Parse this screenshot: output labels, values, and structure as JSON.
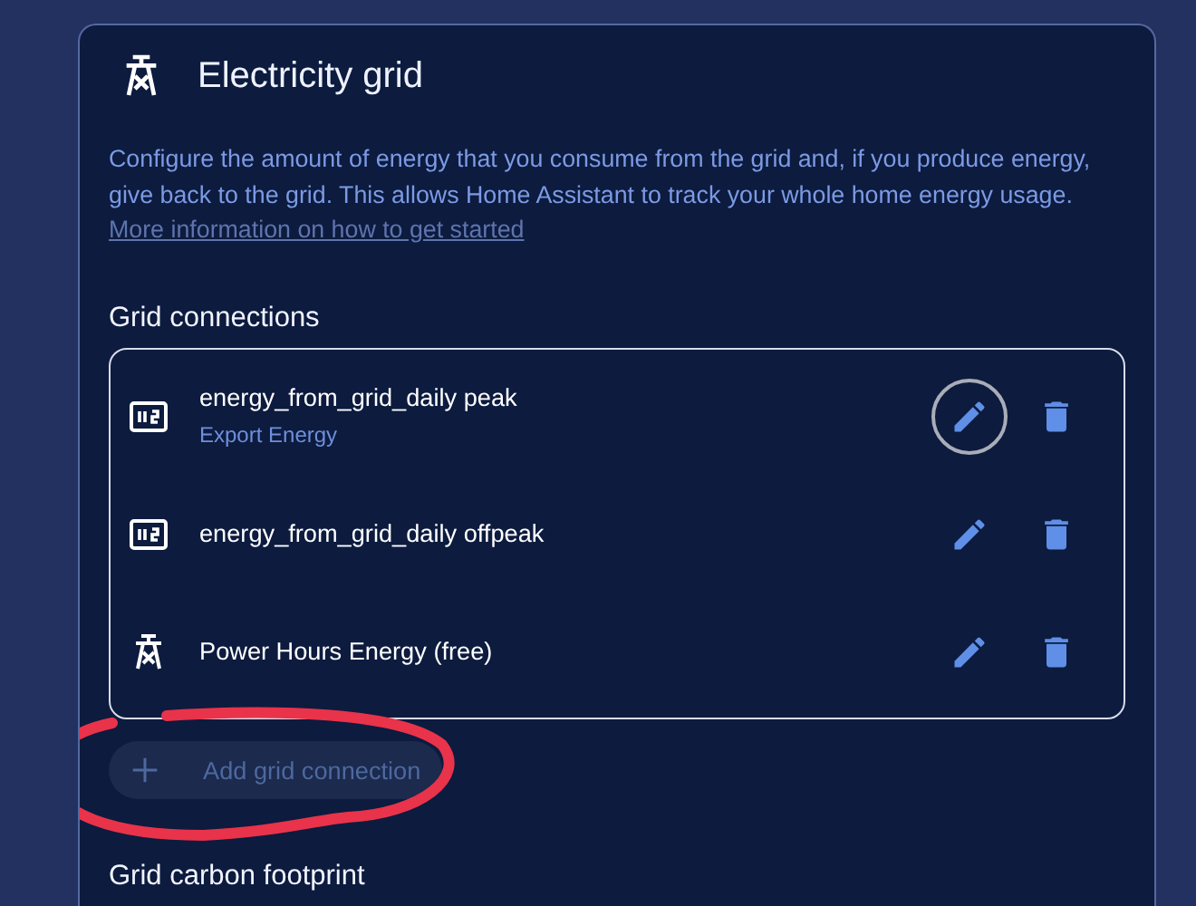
{
  "card": {
    "title": "Electricity grid",
    "description": "Configure the amount of energy that you consume from the grid and, if you produce energy, give back to the grid. This allows Home Assistant to track your whole home energy usage.",
    "link": "More information on how to get started"
  },
  "grid_connections": {
    "heading": "Grid connections",
    "items": [
      {
        "kind": "meter",
        "name": "energy_from_grid_daily peak",
        "subtitle": "Export Energy",
        "focused": true
      },
      {
        "kind": "meter",
        "name": "energy_from_grid_daily offpeak",
        "focused": false
      },
      {
        "kind": "tower",
        "name": "Power Hours Energy (free)",
        "focused": false
      }
    ],
    "add_button": {
      "label": "Add grid connection",
      "disabled": true
    }
  },
  "next_section": {
    "heading": "Grid carbon footprint"
  },
  "annotation": {
    "kind": "ellipse",
    "color": "#e8334a"
  }
}
